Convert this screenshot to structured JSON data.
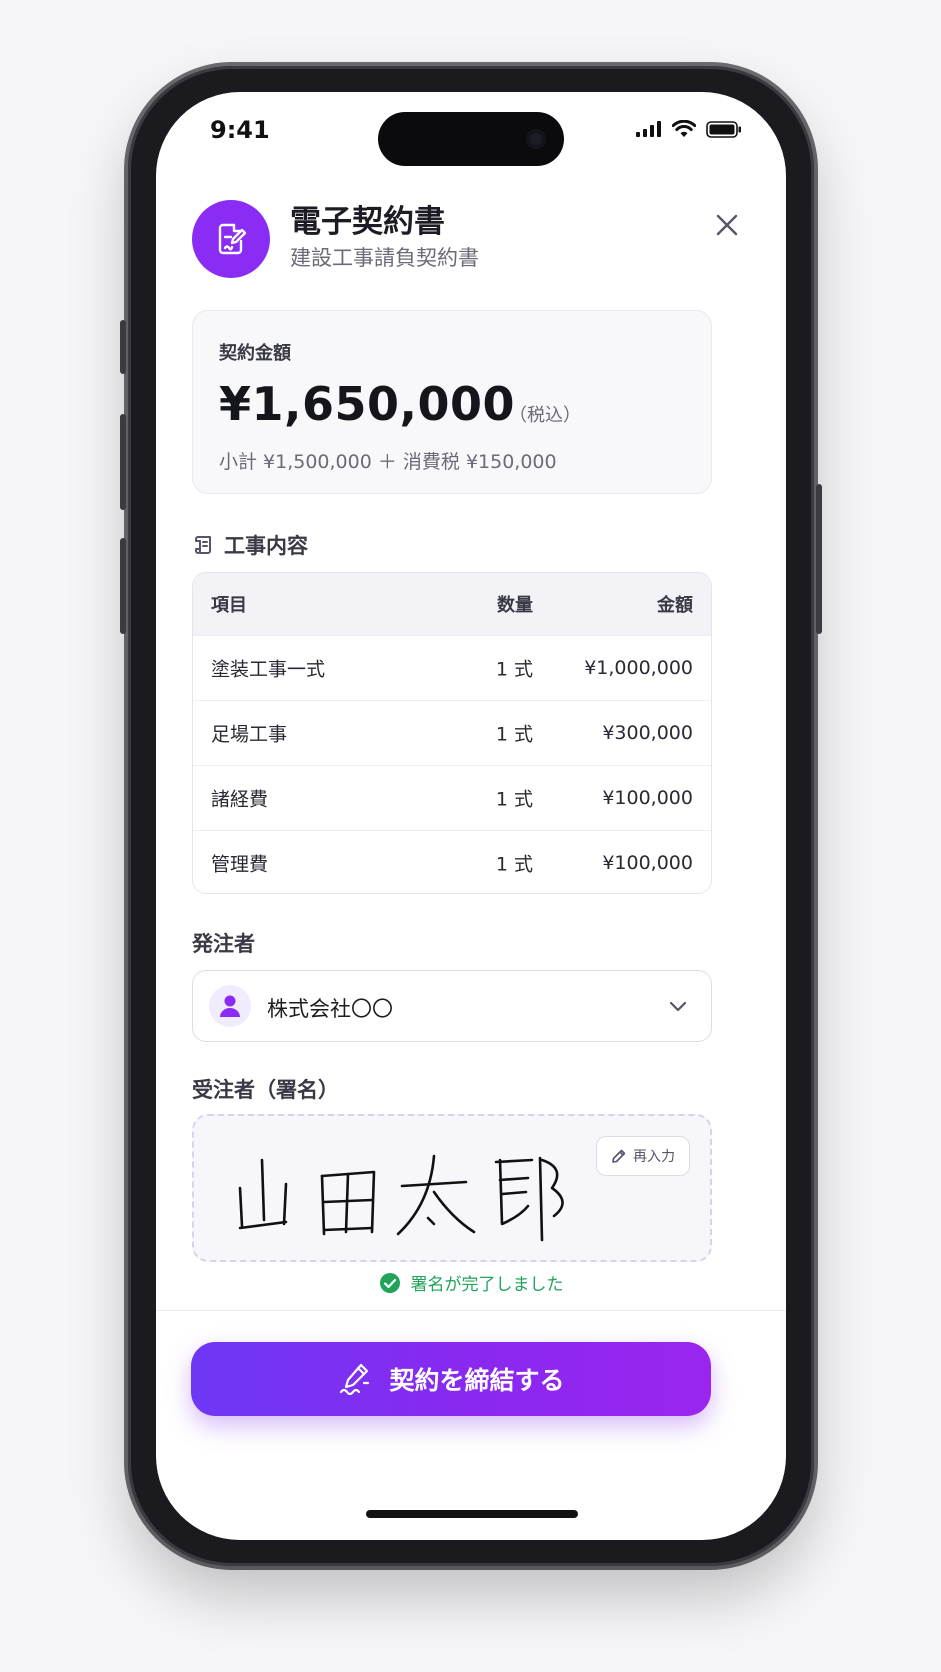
{
  "status_bar": {
    "time": "9:41"
  },
  "header": {
    "title": "電子契約書",
    "subtitle": "建設工事請負契約書"
  },
  "amount": {
    "label": "契約金額",
    "value": "¥1,650,000",
    "tax_note": "（税込）",
    "breakdown": "小計 ¥1,500,000 ＋ 消費税 ¥150,000"
  },
  "work": {
    "section_title": "工事内容",
    "columns": [
      "項目",
      "数量",
      "金額"
    ],
    "rows": [
      {
        "item": "塗装工事一式",
        "qty": "1 式",
        "amount": "¥1,000,000"
      },
      {
        "item": "足場工事",
        "qty": "1 式",
        "amount": "¥300,000"
      },
      {
        "item": "諸経費",
        "qty": "1 式",
        "amount": "¥100,000"
      },
      {
        "item": "管理費",
        "qty": "1 式",
        "amount": "¥100,000"
      }
    ]
  },
  "orderer": {
    "label": "発注者",
    "selected": "株式会社〇〇"
  },
  "signer": {
    "label": "受注者（署名）",
    "reenter_label": "再入力",
    "signature": "山田太郎",
    "status": "署名が完了しました"
  },
  "submit": {
    "label": "契約を締結する"
  },
  "colors": {
    "accent": "#8b2cf5",
    "cta_start": "#6d38f5",
    "cta_end": "#9a26ee",
    "success": "#22a35a"
  },
  "icons": [
    "document-sign-icon",
    "close-icon",
    "scroll-icon",
    "user-icon",
    "chevron-down-icon",
    "pencil-icon",
    "check-circle-icon",
    "signature-pen-icon"
  ]
}
